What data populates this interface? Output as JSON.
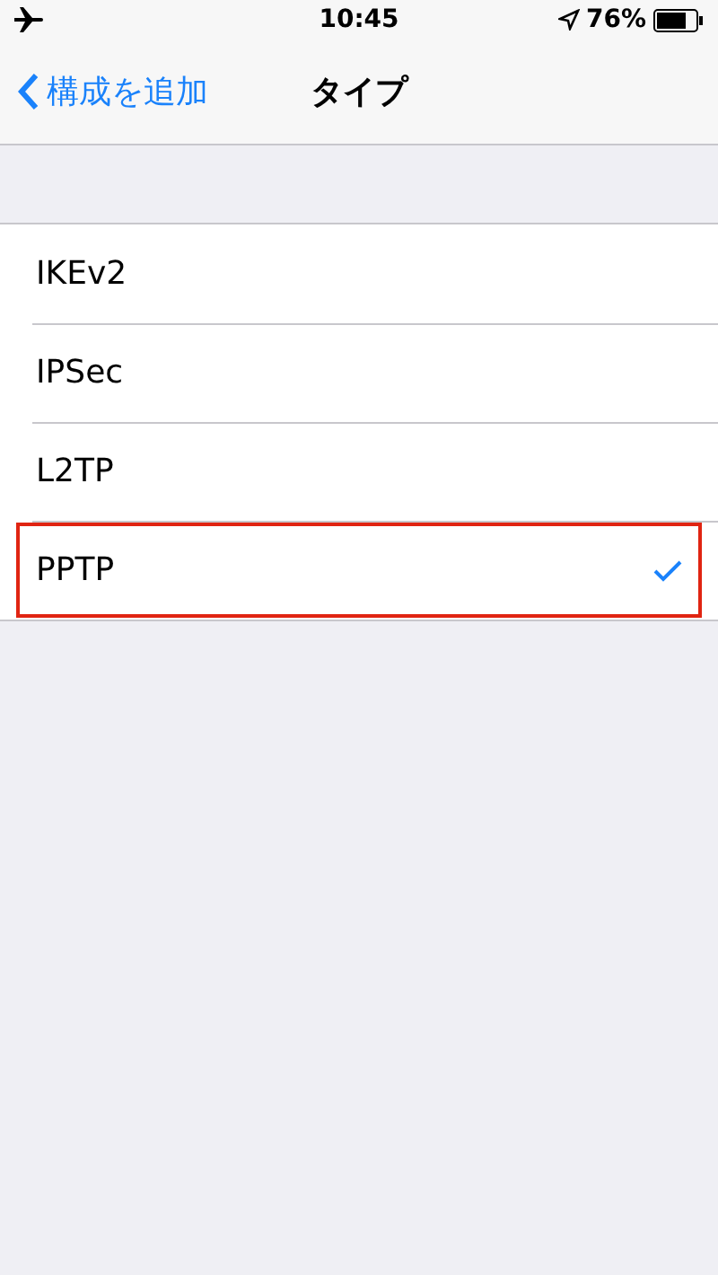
{
  "status_bar": {
    "time": "10:45",
    "battery": "76%"
  },
  "nav": {
    "back": "構成を追加",
    "title": "タイプ"
  },
  "options": [
    {
      "label": "IKEv2",
      "selected": false,
      "highlighted": false
    },
    {
      "label": "IPSec",
      "selected": false,
      "highlighted": false
    },
    {
      "label": "L2TP",
      "selected": false,
      "highlighted": false
    },
    {
      "label": "PPTP",
      "selected": true,
      "highlighted": true
    }
  ]
}
